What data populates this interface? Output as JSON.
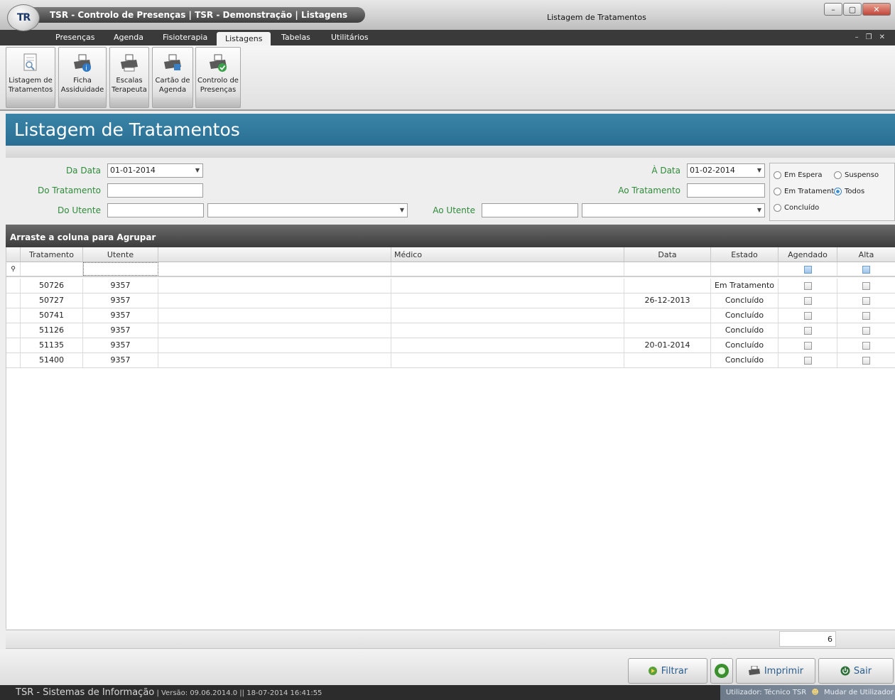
{
  "titlebar": {
    "app_title": "TSR - Controlo de Presenças  |  TSR - Demonstração  |  Listagens",
    "window_title": "Listagem de Tratamentos",
    "logo_text": "TR"
  },
  "menu": {
    "items": [
      "Presenças",
      "Agenda",
      "Fisioterapia",
      "Listagens",
      "Tabelas",
      "Utilitários"
    ],
    "active": "Listagens"
  },
  "ribbon": {
    "buttons": [
      {
        "label": "Listagem de\nTratamentos",
        "icon": "document-search-icon"
      },
      {
        "label": "Ficha\nAssiduidade",
        "icon": "printer-info-icon"
      },
      {
        "label": "Escalas\nTerapeuta",
        "icon": "printer-icon"
      },
      {
        "label": "Cartão de\nAgenda",
        "icon": "printer-icon"
      },
      {
        "label": "Controlo de\nPresenças",
        "icon": "printer-check-icon"
      }
    ]
  },
  "page": {
    "title": "Listagem de Tratamentos"
  },
  "filters": {
    "da_data_label": "Da Data",
    "da_data_value": "01-01-2014",
    "a_data_label": "À Data",
    "a_data_value": "01-02-2014",
    "do_tratamento_label": "Do Tratamento",
    "ao_tratamento_label": "Ao Tratamento",
    "do_utente_label": "Do Utente",
    "ao_utente_label": "Ao Utente",
    "status_options": [
      {
        "label": "Em Espera",
        "selected": false
      },
      {
        "label": "Suspenso",
        "selected": false
      },
      {
        "label": "Em Tratamento",
        "selected": false
      },
      {
        "label": "Todos",
        "selected": true
      },
      {
        "label": "Concluído",
        "selected": false
      }
    ]
  },
  "grid": {
    "group_hint": "Arraste a coluna para Agrupar",
    "columns": [
      "Tratamento",
      "Utente",
      "",
      "Médico",
      "Data",
      "Estado",
      "Agendado",
      "Alta"
    ],
    "rows": [
      {
        "tratamento": "50726",
        "utente": "9357",
        "data": "",
        "estado": "Em Tratamento"
      },
      {
        "tratamento": "50727",
        "utente": "9357",
        "data": "26-12-2013",
        "estado": "Concluído"
      },
      {
        "tratamento": "50741",
        "utente": "9357",
        "data": "",
        "estado": "Concluído"
      },
      {
        "tratamento": "51126",
        "utente": "9357",
        "data": "",
        "estado": "Concluído"
      },
      {
        "tratamento": "51135",
        "utente": "9357",
        "data": "20-01-2014",
        "estado": "Concluído"
      },
      {
        "tratamento": "51400",
        "utente": "9357",
        "data": "",
        "estado": "Concluído"
      }
    ],
    "count": "6"
  },
  "actions": {
    "filtrar": "Filtrar",
    "imprimir": "Imprimir",
    "sair": "Sair"
  },
  "status": {
    "company": "TSR - Sistemas de Informação",
    "version": "| Versão:  09.06.2014.0 || 18-07-2014 16:41:55",
    "user": "Utilizador:  Técnico TSR",
    "change_user": "Mudar de Utilizador"
  },
  "colors": {
    "header_blue": "#2f7aa0",
    "label_green": "#2e8b3a",
    "dark_bar": "#3a3a3a"
  }
}
